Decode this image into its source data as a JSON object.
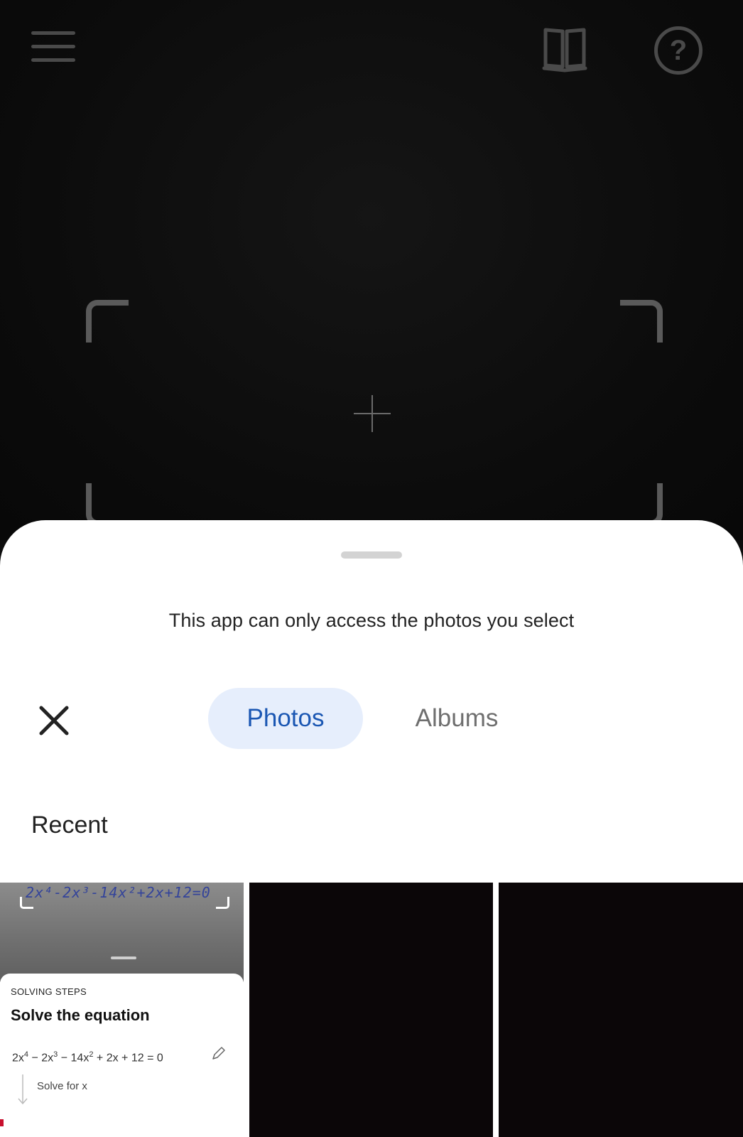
{
  "camera": {
    "toolbar": {
      "menu_icon": "hamburger-menu-icon",
      "book_icon": "open-book-icon",
      "help_icon": "help-circle-icon",
      "help_glyph": "?"
    }
  },
  "picker": {
    "notice": "This app can only access the photos you select",
    "tabs": [
      {
        "label": "Photos",
        "selected": true
      },
      {
        "label": "Albums",
        "selected": false
      }
    ],
    "section_title": "Recent",
    "thumbnails": [
      {
        "equation_strip": "2x⁴-2x³-14x²+2x+12=0",
        "card_label": "SOLVING STEPS",
        "card_heading": "Solve the equation",
        "math_parts": [
          "2x",
          "4",
          " − 2x",
          "3",
          " − 14x",
          "2",
          " + 2x + 12 = 0"
        ],
        "sub_label": "Solve for x"
      },
      {
        "type": "dark-photo"
      },
      {
        "type": "dark-photo"
      }
    ]
  },
  "colors": {
    "accent": "#1b57b3",
    "tab_selected_bg": "#e6eefc",
    "camera_bg": "#0d0d0d"
  }
}
